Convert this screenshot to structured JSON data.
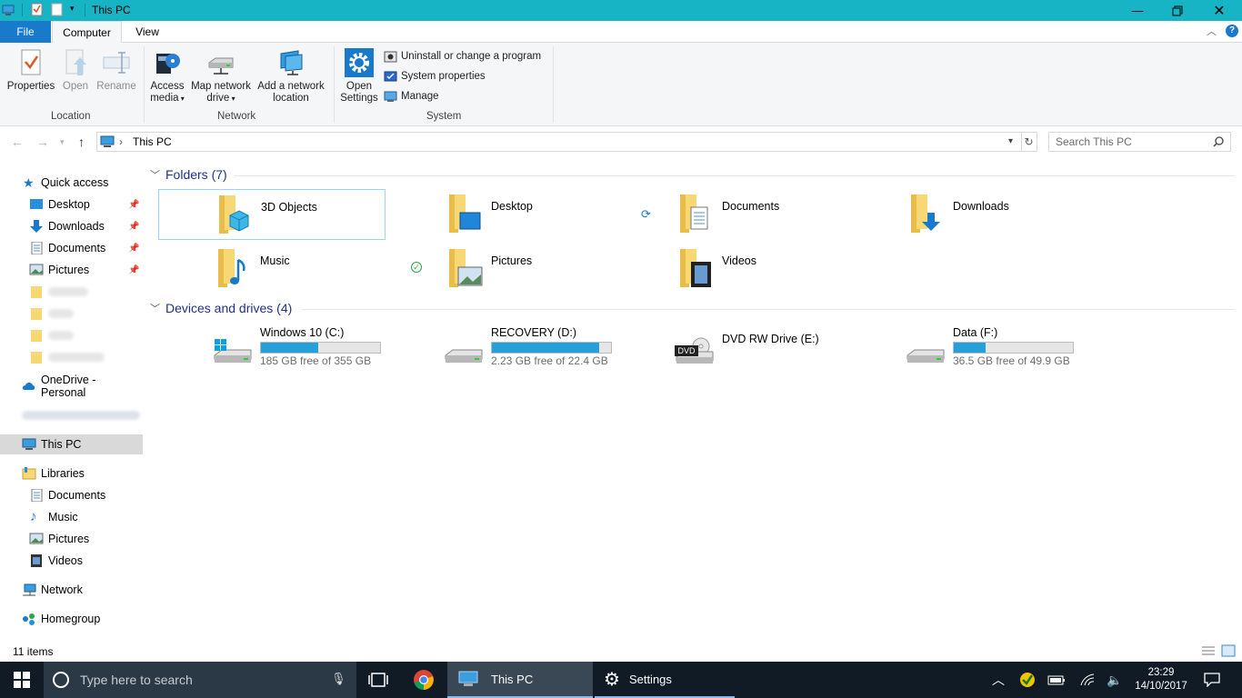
{
  "window": {
    "title": "This PC"
  },
  "tabs": {
    "file": "File",
    "computer": "Computer",
    "view": "View"
  },
  "ribbon": {
    "location": {
      "label": "Location",
      "properties": "Properties",
      "open": "Open",
      "rename": "Rename"
    },
    "network": {
      "label": "Network",
      "access_media_1": "Access",
      "access_media_2": "media",
      "map_drive_1": "Map network",
      "map_drive_2": "drive",
      "add_location_1": "Add a network",
      "add_location_2": "location"
    },
    "system": {
      "label": "System",
      "open_settings_1": "Open",
      "open_settings_2": "Settings",
      "uninstall": "Uninstall or change a program",
      "system_properties": "System properties",
      "manage": "Manage"
    }
  },
  "address": {
    "crumb_sep": "›",
    "path": "This PC",
    "search_placeholder": "Search This PC"
  },
  "sidebar": {
    "quick_access": "Quick access",
    "quick_items": [
      "Desktop",
      "Downloads",
      "Documents",
      "Pictures"
    ],
    "onedrive": "OneDrive - Personal",
    "this_pc": "This PC",
    "libraries": "Libraries",
    "library_items": [
      "Documents",
      "Music",
      "Pictures",
      "Videos"
    ],
    "network": "Network",
    "homegroup": "Homegroup"
  },
  "folders": {
    "heading": "Folders (7)",
    "items": [
      "3D Objects",
      "Desktop",
      "Documents",
      "Downloads",
      "Music",
      "Pictures",
      "Videos"
    ]
  },
  "drives": {
    "heading": "Devices and drives (4)",
    "items": [
      {
        "name": "Windows 10 (C:)",
        "free": "185 GB free of 355 GB",
        "used_fraction": 0.48
      },
      {
        "name": "RECOVERY (D:)",
        "free": "2.23 GB free of 22.4 GB",
        "used_fraction": 0.9
      },
      {
        "name": "DVD RW Drive (E:)",
        "free": "",
        "used_fraction": 0
      },
      {
        "name": "Data (F:)",
        "free": "36.5 GB free of 49.9 GB",
        "used_fraction": 0.27
      }
    ],
    "dvd_badge": "DVD"
  },
  "status": {
    "items": "11 items"
  },
  "taskbar": {
    "search_placeholder": "Type here to search",
    "explorer": "This PC",
    "settings": "Settings",
    "time": "23:29",
    "date": "14/10/2017"
  },
  "colors": {
    "titlebar": "#16b4c4",
    "accent": "#1979ca",
    "taskbar": "#101b26",
    "drive_fill": "#26a0da"
  }
}
